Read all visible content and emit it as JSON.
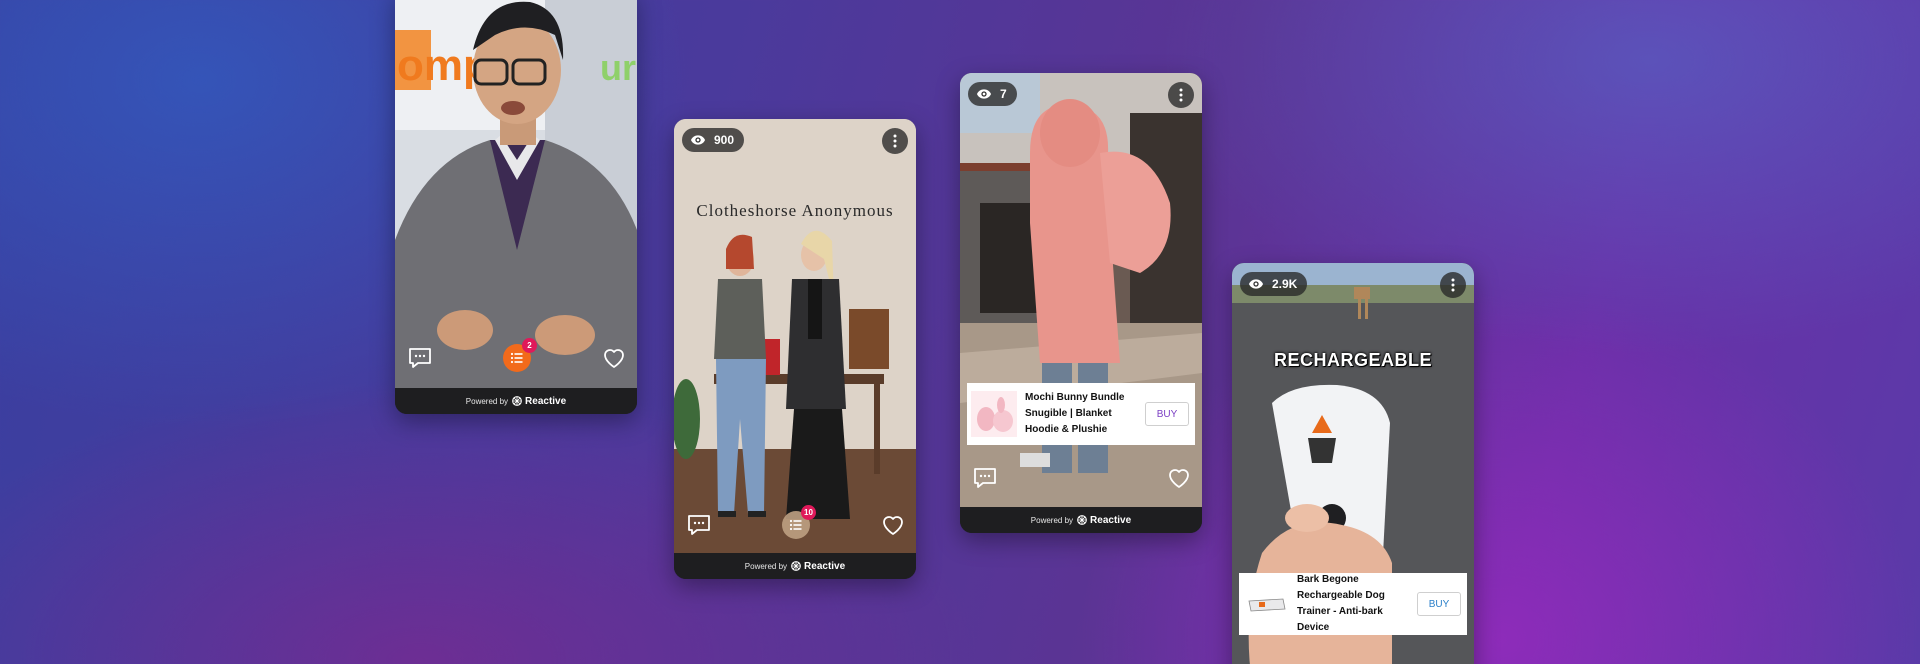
{
  "footer": {
    "powered_by": "Powered by",
    "brand": "Reactive"
  },
  "colors": {
    "accent_orange": "#f26a1b",
    "badge_pink": "#e0195a",
    "buy_purple": "#7b3fc4",
    "buy_blue": "#2a7fc9"
  },
  "cards": [
    {
      "video_subject": "presenter-in-gray-cardigan",
      "background_sign_partial": "omp",
      "background_sign_partial_right": "ura",
      "list_badge_count": "2",
      "icons": [
        "comment-icon",
        "list-icon",
        "heart-icon"
      ]
    },
    {
      "views": "900",
      "sign_text": "Clotheshorse Anonymous",
      "list_badge_count": "10",
      "icons": [
        "eye-icon",
        "more-icon",
        "comment-icon",
        "list-icon",
        "heart-icon"
      ]
    },
    {
      "views": "7",
      "product_name": "Mochi Bunny Bundle Snugible | Blanket Hoodie & Plushie",
      "buy_label": "BUY",
      "icons": [
        "eye-icon",
        "more-icon",
        "comment-icon",
        "heart-icon"
      ]
    },
    {
      "views": "2.9K",
      "overlay_text": "RECHARGEABLE",
      "product_name": "Bark Begone Rechargeable Dog Trainer - Anti-bark Device",
      "buy_label": "BUY",
      "icons": [
        "eye-icon",
        "more-icon"
      ]
    }
  ]
}
